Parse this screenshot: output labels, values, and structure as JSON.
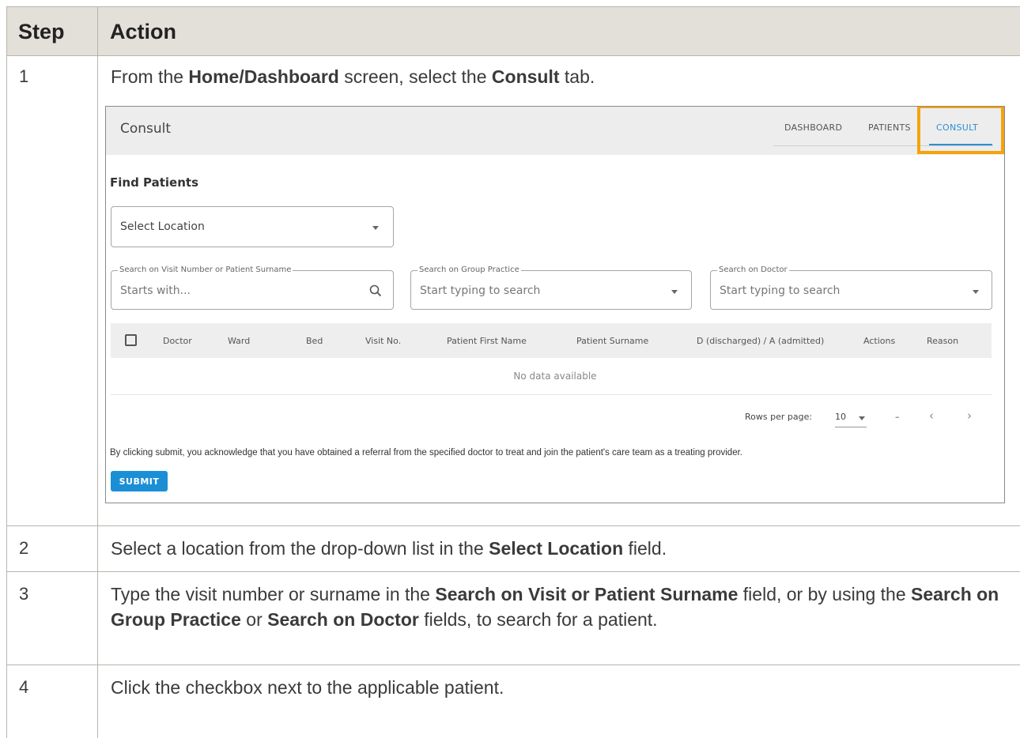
{
  "header": {
    "step": "Step",
    "action": "Action"
  },
  "steps": [
    {
      "num": "1",
      "parts": [
        {
          "t": "From the "
        },
        {
          "b": "Home/Dashboard"
        },
        {
          "t": " screen, select the "
        },
        {
          "b": "Consult"
        },
        {
          "t": " tab."
        }
      ]
    },
    {
      "num": "2",
      "parts": [
        {
          "t": "Select a location from the drop-down list in the "
        },
        {
          "b": "Select Location"
        },
        {
          "t": " field."
        }
      ]
    },
    {
      "num": "3",
      "parts": [
        {
          "t": "Type the visit number or surname in the "
        },
        {
          "b": "Search on Visit or Patient Surname"
        },
        {
          "t": " field, or by using the "
        },
        {
          "b": "Search on Group Practice"
        },
        {
          "t": " or "
        },
        {
          "b": "Search on Doctor"
        },
        {
          "t": " fields, to search for a patient."
        }
      ]
    },
    {
      "num": "4",
      "parts": [
        {
          "t": "Click the checkbox next to the applicable patient."
        }
      ]
    }
  ],
  "screenshot": {
    "app_title": "Consult",
    "nav": {
      "dashboard": "DASHBOARD",
      "patients": "PATIENTS",
      "consult": "CONSULT"
    },
    "find_title": "Find Patients",
    "select_location": "Select Location",
    "search_visit": {
      "label": "Search on Visit Number or Patient Surname",
      "placeholder": "Starts with..."
    },
    "search_group": {
      "label": "Search on Group Practice",
      "placeholder": "Start typing to search"
    },
    "search_doctor": {
      "label": "Search on Doctor",
      "placeholder": "Start typing to search"
    },
    "columns": {
      "doctor": "Doctor",
      "ward": "Ward",
      "bed": "Bed",
      "visit": "Visit No.",
      "first": "Patient First Name",
      "surname": "Patient Surname",
      "status": "D (discharged) / A (admitted)",
      "actions": "Actions",
      "reason": "Reason"
    },
    "no_data": "No data available",
    "pager": {
      "rows_label": "Rows per page:",
      "rows_value": "10",
      "range": "–",
      "prev": "‹",
      "next": "›"
    },
    "disclaimer": "By clicking submit, you acknowledge that you have obtained a referral from the specified doctor to treat and join the patient's care team as a treating provider.",
    "submit": "SUBMIT"
  },
  "colors": {
    "header_bg": "#e3e0da",
    "highlight": "#f5a30a",
    "accent": "#1b8fd6"
  }
}
